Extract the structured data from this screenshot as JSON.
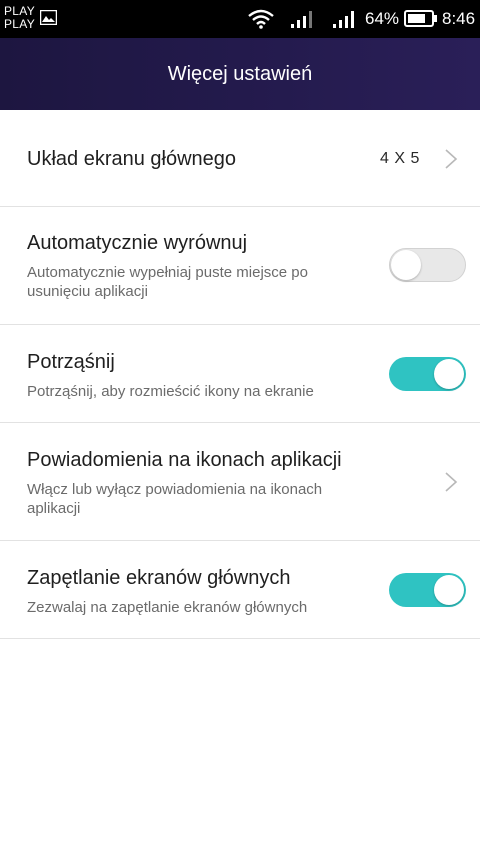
{
  "status_bar": {
    "carrier_line1": "PLAY",
    "carrier_line2": "PLAY",
    "battery_percent": "64%",
    "time": "8:46",
    "icons": [
      "gallery-icon",
      "wifi-icon",
      "signal-icon",
      "signal-icon",
      "battery-icon"
    ]
  },
  "header": {
    "title": "Więcej ustawień"
  },
  "settings": [
    {
      "title": "Układ ekranu głównego",
      "value": "4 X 5"
    },
    {
      "title": "Automatycznie wyrównuj",
      "subtitle": "Automatycznie wypełniaj puste miejsce po usunięciu aplikacji",
      "toggle": "off"
    },
    {
      "title": "Potrząśnij",
      "subtitle": "Potrząśnij, aby rozmieścić ikony na ekranie",
      "toggle": "on"
    },
    {
      "title": "Powiadomienia na ikonach aplikacji",
      "subtitle": "Włącz lub wyłącz powiadomienia na ikonach aplikacji"
    },
    {
      "title": "Zapętlanie ekranów głównych",
      "subtitle": "Zezwalaj na zapętlanie ekranów głównych",
      "toggle": "on"
    }
  ],
  "colors": {
    "header_bg": "#231a4c",
    "toggle_on": "#2fc3c2",
    "toggle_off": "#e8e8e8"
  }
}
